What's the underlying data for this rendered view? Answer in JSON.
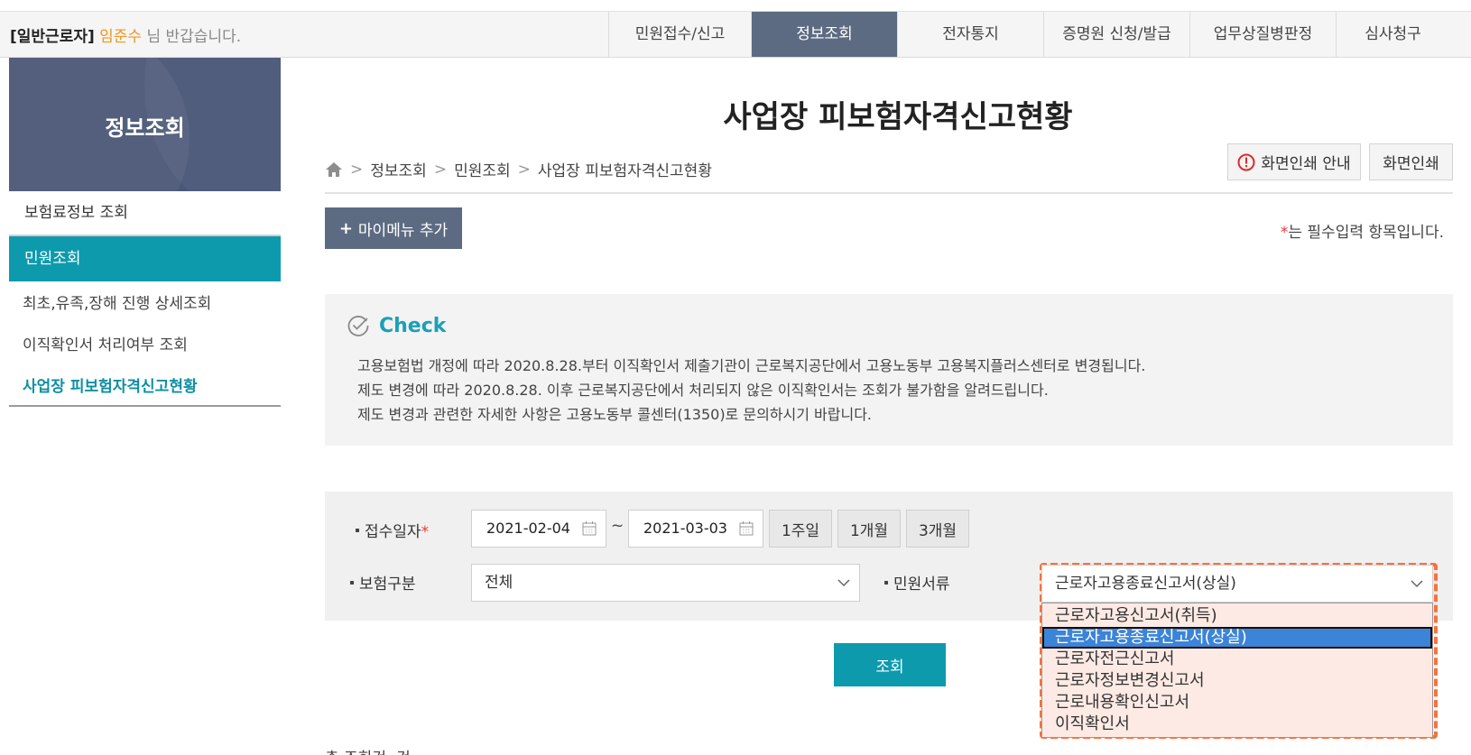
{
  "header": {
    "role": "[일반근로자]",
    "user_name": "임준수",
    "greeting_suffix": "님 반갑습니다.",
    "nav": [
      {
        "label": "민원접수/신고",
        "active": false
      },
      {
        "label": "정보조회",
        "active": true
      },
      {
        "label": "전자통지",
        "active": false
      },
      {
        "label": "증명원 신청/발급",
        "active": false
      },
      {
        "label": "업무상질병판정",
        "active": false
      },
      {
        "label": "심사청구",
        "active": false
      }
    ]
  },
  "sidebar": {
    "title": "정보조회",
    "items": [
      {
        "label": "보험료정보 조회"
      },
      {
        "label": "민원조회"
      },
      {
        "label": "최초,유족,장해 진행 상세조회"
      },
      {
        "label": "이직확인서 처리여부 조회"
      },
      {
        "label": "사업장 피보험자격신고현황"
      }
    ]
  },
  "main": {
    "title": "사업장 피보험자격신고현황",
    "breadcrumb": [
      "정보조회",
      "민원조회",
      "사업장 피보험자격신고현황"
    ],
    "print_guide_label": "화면인쇄 안내",
    "print_label": "화면인쇄",
    "add_menu_label": "마이메뉴 추가",
    "required_star": "*",
    "required_note": "는 필수입력 항목입니다.",
    "check": {
      "title": "Check",
      "lines": [
        "고용보험법 개정에 따라 2020.8.28.부터 이직확인서 제출기관이 근로복지공단에서 고용노동부 고용복지플러스센터로 변경됩니다.",
        "제도 변경에 따라 2020.8.28. 이후 근로복지공단에서 처리되지 않은 이직확인서는 조회가 불가함을 알려드립니다.",
        "제도 변경과 관련한 자세한 사항은 고용노동부 콜센터(1350)로 문의하시기 바랍니다."
      ]
    },
    "search": {
      "date_label": "접수일자",
      "date_from": "2021-02-04",
      "date_to": "2021-03-03",
      "tilde": "~",
      "periods": [
        "1주일",
        "1개월",
        "3개월"
      ],
      "insurance_label": "보험구분",
      "insurance_value": "전체",
      "doc_label": "민원서류",
      "doc_value": "근로자고용종료신고서(상실)",
      "doc_options": [
        "근로자고용신고서(취득)",
        "근로자고용종료신고서(상실)",
        "근로자전근신고서",
        "근로자정보변경신고서",
        "근로내용확인신고서",
        "이직확인서"
      ],
      "doc_selected_index": 1,
      "submit_label": "조회"
    },
    "bottom_partial": "총 조회건: 건"
  },
  "colors": {
    "nav_active": "#5d6b82",
    "teal": "#0e9aad",
    "sidebar_head": "#4a5777",
    "highlight": "#f4723f",
    "option_selected": "#3b84d8"
  }
}
